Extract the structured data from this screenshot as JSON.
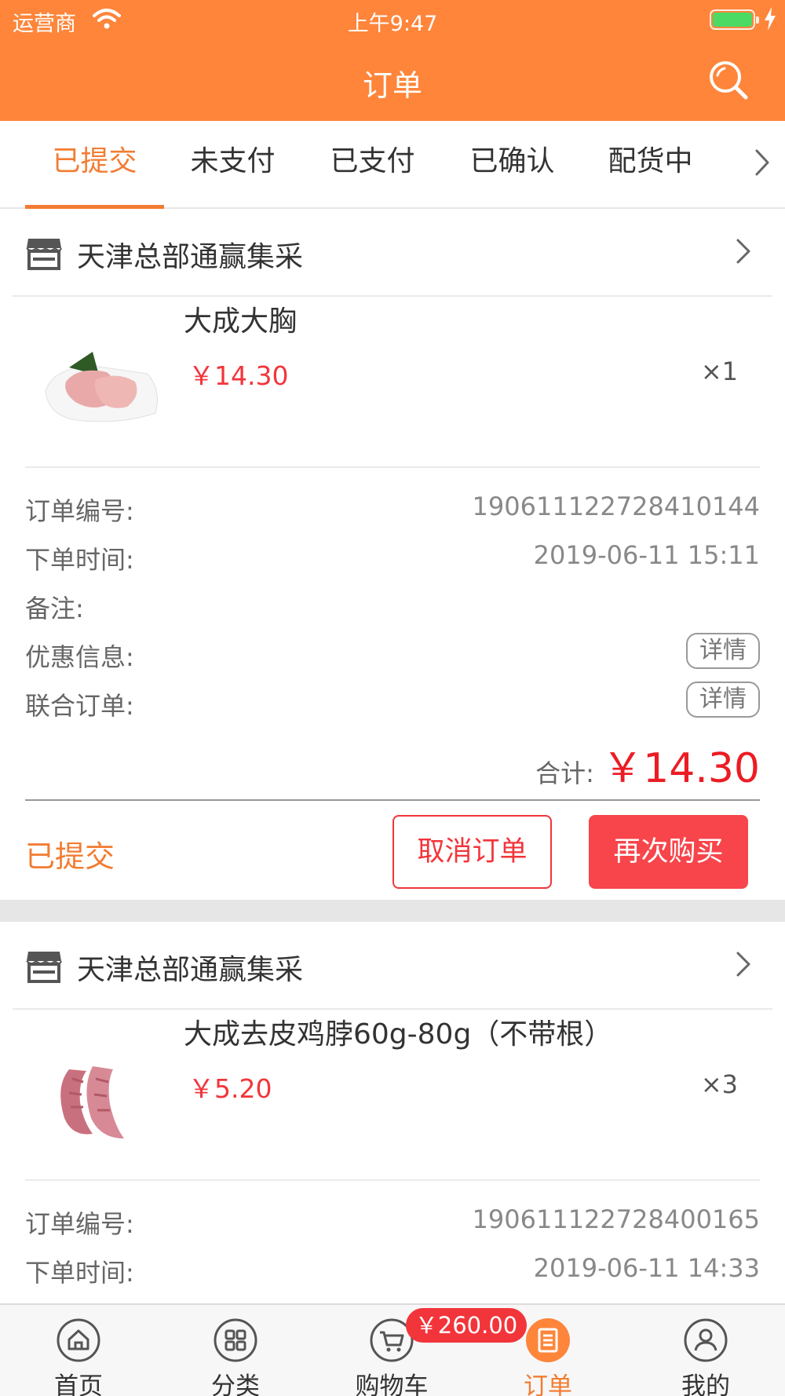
{
  "status_bar": {
    "carrier": "运营商",
    "time": "上午9:47"
  },
  "header": {
    "title": "订单"
  },
  "tabs": [
    {
      "label": "已提交",
      "active": true
    },
    {
      "label": "未支付",
      "active": false
    },
    {
      "label": "已支付",
      "active": false
    },
    {
      "label": "已确认",
      "active": false
    },
    {
      "label": "配货中",
      "active": false
    }
  ],
  "orders": [
    {
      "store": "天津总部通赢集采",
      "product": {
        "name": "大成大胸",
        "price": "￥14.30",
        "qty": "×1"
      },
      "info": {
        "order_no_label": "订单编号:",
        "order_no": "190611122728410144",
        "time_label": "下单时间:",
        "time": "2019-06-11 15:11",
        "remark_label": "备注:",
        "discount_label": "优惠信息:",
        "discount_btn": "详情",
        "joint_label": "联合订单:",
        "joint_btn": "详情"
      },
      "total_label": "合计:",
      "total": "￥14.30",
      "status": "已提交",
      "cancel_label": "取消订单",
      "rebuy_label": "再次购买"
    },
    {
      "store": "天津总部通赢集采",
      "product": {
        "name": "大成去皮鸡脖60g-80g（不带根）",
        "price": "￥5.20",
        "qty": "×3"
      },
      "info": {
        "order_no_label": "订单编号:",
        "order_no": "190611122728400165",
        "time_label": "下单时间:",
        "time": "2019-06-11 14:33"
      }
    }
  ],
  "tabbar": {
    "items": [
      {
        "label": "首页",
        "icon": "home-icon"
      },
      {
        "label": "分类",
        "icon": "grid-icon"
      },
      {
        "label": "购物车",
        "icon": "cart-icon"
      },
      {
        "label": "订单",
        "icon": "order-list-icon",
        "active": true
      },
      {
        "label": "我的",
        "icon": "user-icon"
      }
    ],
    "cart_badge": "￥260.00"
  },
  "colors": {
    "accent": "#fe853a",
    "price_red": "#f2353b",
    "status_orange": "#f37c32"
  }
}
